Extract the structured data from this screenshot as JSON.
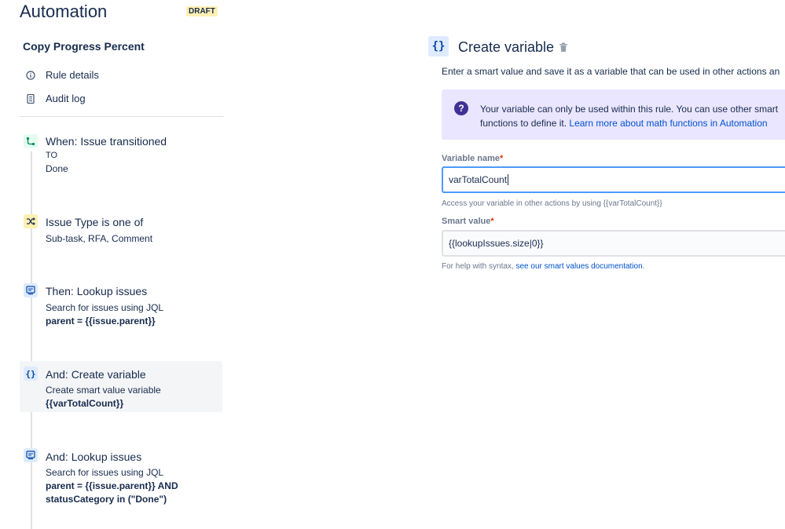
{
  "header": {
    "title": "Automation",
    "badge": "DRAFT"
  },
  "sidebar": {
    "rule_name": "Copy Progress Percent",
    "nav": [
      {
        "label": "Rule details",
        "icon": "info-icon"
      },
      {
        "label": "Audit log",
        "icon": "document-icon"
      }
    ],
    "steps": [
      {
        "title": "When: Issue transitioned",
        "lines": [
          "TO",
          "Done"
        ],
        "icon": "transition-icon"
      },
      {
        "title": "Issue Type is one of",
        "lines": [
          "Sub-task, RFA, Comment"
        ],
        "icon": "shuffle-icon"
      },
      {
        "title": "Then: Lookup issues",
        "line1": "Search for issues using JQL",
        "line2": "parent = {{issue.parent}}",
        "icon": "lookup-icon"
      },
      {
        "title": "And: Create variable",
        "line1": "Create smart value variable",
        "line2": "{{varTotalCount}}",
        "icon": "braces-icon"
      },
      {
        "title": "And: Lookup issues",
        "line1": "Search for issues using JQL",
        "line2": "parent = {{issue.parent}} AND",
        "line3": "statusCategory in (\"Done\")",
        "icon": "lookup-icon"
      }
    ]
  },
  "panel": {
    "icon_text": "{}",
    "title": "Create variable",
    "description": "Enter a smart value and save it as a variable that can be used in other actions an",
    "info": {
      "line1": "Your variable can only be used within this rule. You can use other smart",
      "line2": "functions to define it. ",
      "link": "Learn more about math functions in Automation"
    },
    "variable_name": {
      "label": "Variable name",
      "required": "*",
      "value": "varTotalCount",
      "help": "Access your variable in other actions by using {{varTotalCount}}"
    },
    "smart_value": {
      "label": "Smart value",
      "required": "*",
      "value": "{{lookupIssues.size|0}}",
      "help_prefix": "For help with syntax, ",
      "help_link": "see our smart values documentation",
      "help_suffix": "."
    }
  },
  "colors": {
    "accent": "#0052cc",
    "info_bg": "#eae6ff",
    "focus_border": "#4c9aff",
    "selected_bg": "#f4f5f7"
  }
}
